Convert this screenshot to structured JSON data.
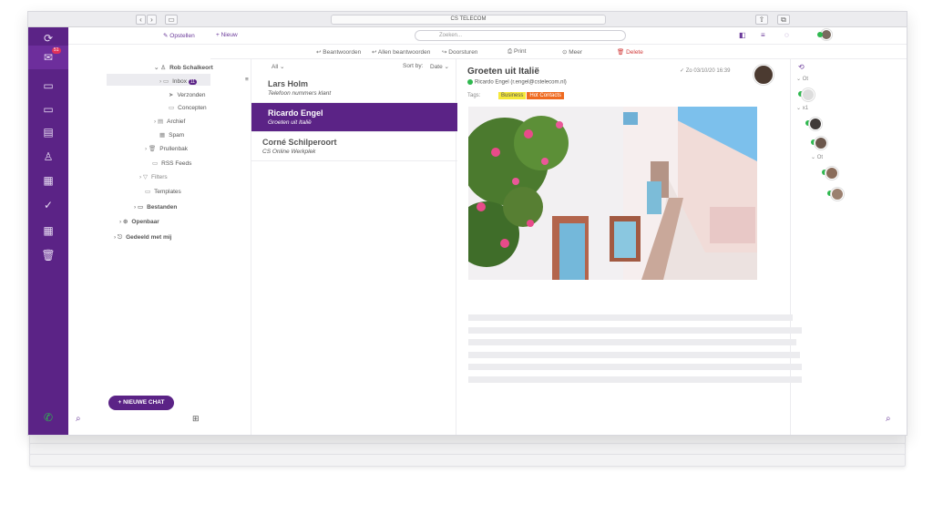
{
  "browser": {
    "url_title": "CS TELECOM"
  },
  "toolbar": {
    "compose": "Opstellen",
    "new": "Nieuw",
    "search_placeholder": "Zoeken...",
    "reply": "Beantwoorden",
    "reply_all": "Allen beantwoorden",
    "forward": "Doorsturen",
    "print": "Print",
    "more": "Meer",
    "delete": "Delete"
  },
  "rail": {
    "mail_badge": "51"
  },
  "folders": {
    "account": "Rob Schalkeort",
    "inbox": "Inbox",
    "inbox_count": "11",
    "sent": "Verzonden",
    "drafts": "Concepten",
    "archive": "Archief",
    "spam": "Spam",
    "trash": "Prullenbak",
    "rss": "RSS Feeds",
    "filters": "Filters",
    "templates": "Templates",
    "files": "Bestanden",
    "public": "Openbaar",
    "shared": "Gedeeld met mij",
    "new_chat": "NIEUWE CHAT"
  },
  "list": {
    "filter": "All",
    "sort_label": "Sort by:",
    "sort_value": "Date",
    "messages": [
      {
        "sender": "Lars Holm",
        "preview": "Telefoon nummers klant"
      },
      {
        "sender": "Ricardo Engel",
        "preview": "Groeten uit Italië"
      },
      {
        "sender": "Corné Schilperoort",
        "preview": "CS Online Werkplek"
      }
    ]
  },
  "reading": {
    "subject": "Groeten uit Italië",
    "from": "Ricardo Engel (r.engel@cstelecom.nl)",
    "date": "Zo 03/10/20 16:39",
    "tags_label": "Tags:",
    "tags": [
      "Business",
      "Hot Contacts"
    ]
  },
  "contacts": {
    "groups": [
      "Ot",
      "x1",
      "Ot"
    ]
  },
  "colors": {
    "brand": "#5b2386",
    "tag_business": "#f5e83b",
    "tag_hot": "#ef6a1f",
    "online": "#2fb84f"
  }
}
